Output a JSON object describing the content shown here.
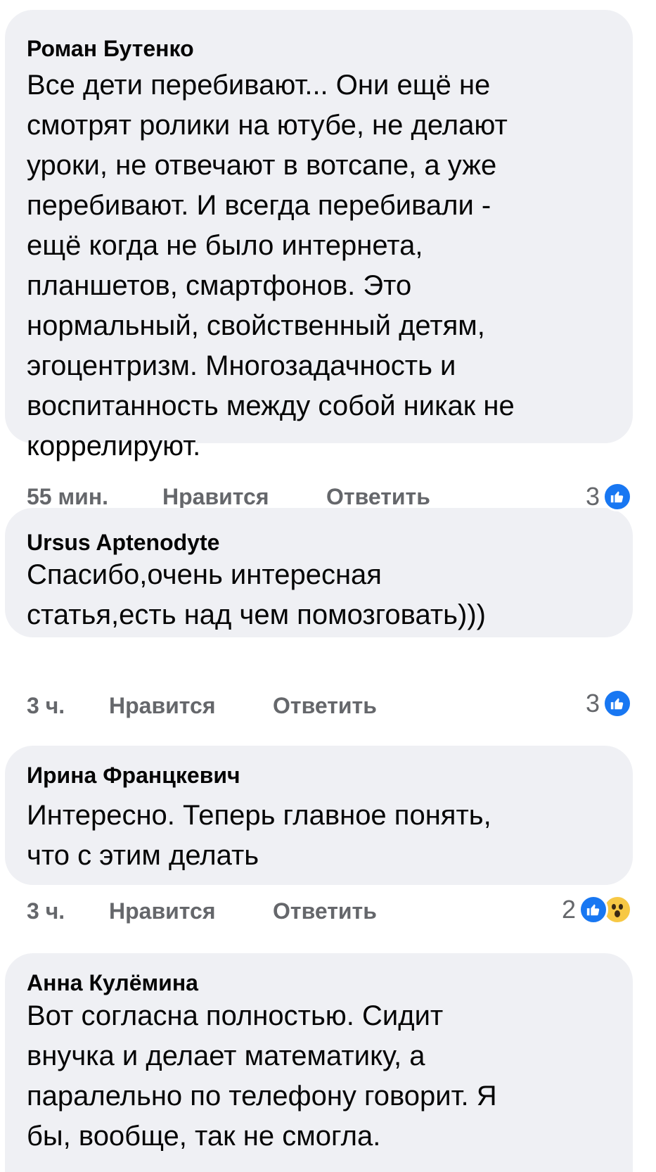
{
  "comments": [
    {
      "author": "Роман Бутенко",
      "text_lines": [
        "Все дети перебивают... Они ещё не",
        "смотрят ролики на ютубе, не делают",
        "уроки, не отвечают в вотсапе, а уже",
        "перебивают. И всегда перебивали -",
        "ещё когда не было интернета,",
        "планшетов, смартфонов. Это",
        "нормальный, свойственный детям,",
        "эгоцентризм. Многозадачность и",
        "воспитанность между собой никак не",
        "коррелируют."
      ],
      "time": "55 мин.",
      "like_label": "Нравится",
      "reply_label": "Ответить",
      "reaction_count": "3",
      "reactions": [
        "like-icon"
      ]
    },
    {
      "author": "Ursus Aptenodyte",
      "text_lines": [
        "Спасибо,очень интересная",
        "статья,есть над чем помозговать)))"
      ],
      "time": "3 ч.",
      "like_label": "Нравится",
      "reply_label": "Ответить",
      "reaction_count": "3",
      "reactions": [
        "like-icon"
      ]
    },
    {
      "author": "Ирина Францкевич",
      "text_lines": [
        "Интересно. Теперь главное понять,",
        "что с этим делать"
      ],
      "time": "3 ч.",
      "like_label": "Нравится",
      "reply_label": "Ответить",
      "reaction_count": "2",
      "reactions": [
        "like-icon",
        "wow-icon"
      ]
    },
    {
      "author": "Анна Кулёмина",
      "text_lines": [
        "Вот согласна полностью. Сидит",
        "внучка и делает математику, а",
        "паралельно по телефону говорит. Я",
        "бы, вообще, так не смогла."
      ]
    }
  ],
  "colors": {
    "bubble": "#eff0f4",
    "meta_text": "#65676b",
    "like_blue": "#1877f2",
    "wow_yellow": "#f7c844"
  }
}
